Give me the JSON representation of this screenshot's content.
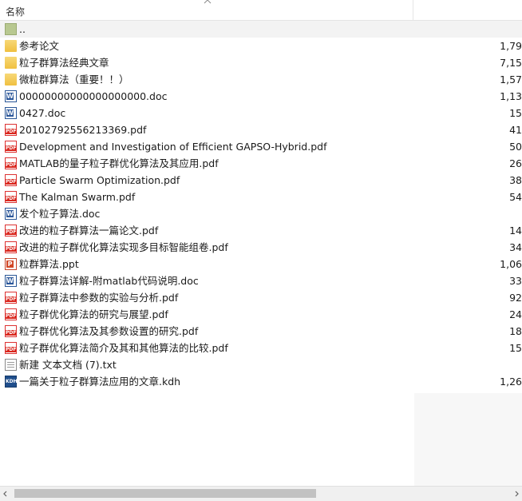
{
  "header": {
    "name_label": "名称"
  },
  "files": [
    {
      "name": "..",
      "size": "",
      "type": "up"
    },
    {
      "name": "参考论文",
      "size": "1,79",
      "type": "folder"
    },
    {
      "name": "粒子群算法经典文章",
      "size": "7,15",
      "type": "folder"
    },
    {
      "name": "微粒群算法（重要！！）",
      "size": "1,57",
      "type": "folder"
    },
    {
      "name": "00000000000000000000.doc",
      "size": "1,13",
      "type": "doc"
    },
    {
      "name": "0427.doc",
      "size": "15",
      "type": "doc"
    },
    {
      "name": "20102792556213369.pdf",
      "size": "41",
      "type": "pdf"
    },
    {
      "name": "Development and Investigation of Efficient GAPSO-Hybrid.pdf",
      "size": "50",
      "type": "pdf"
    },
    {
      "name": "MATLAB的量子粒子群优化算法及其应用.pdf",
      "size": "26",
      "type": "pdf"
    },
    {
      "name": "Particle Swarm Optimization.pdf",
      "size": "38",
      "type": "pdf"
    },
    {
      "name": "The Kalman Swarm.pdf",
      "size": "54",
      "type": "pdf"
    },
    {
      "name": "发个粒子算法.doc",
      "size": "",
      "type": "doc"
    },
    {
      "name": "改进的粒子群算法一篇论文.pdf",
      "size": "14",
      "type": "pdf"
    },
    {
      "name": "改进的粒子群优化算法实现多目标智能组卷.pdf",
      "size": "34",
      "type": "pdf"
    },
    {
      "name": "粒群算法.ppt",
      "size": "1,06",
      "type": "ppt"
    },
    {
      "name": "粒子群算法详解-附matlab代码说明.doc",
      "size": "33",
      "type": "doc"
    },
    {
      "name": "粒子群算法中参数的实验与分析.pdf",
      "size": "92",
      "type": "pdf"
    },
    {
      "name": "粒子群优化算法的研究与展望.pdf",
      "size": "24",
      "type": "pdf"
    },
    {
      "name": "粒子群优化算法及其参数设置的研究.pdf",
      "size": "18",
      "type": "pdf"
    },
    {
      "name": "粒子群优化算法简介及其和其他算法的比较.pdf",
      "size": "15",
      "type": "pdf"
    },
    {
      "name": "新建 文本文档 (7).txt",
      "size": "",
      "type": "txt"
    },
    {
      "name": "一篇关于粒子群算法应用的文章.kdh",
      "size": "1,26",
      "type": "kdh"
    }
  ]
}
